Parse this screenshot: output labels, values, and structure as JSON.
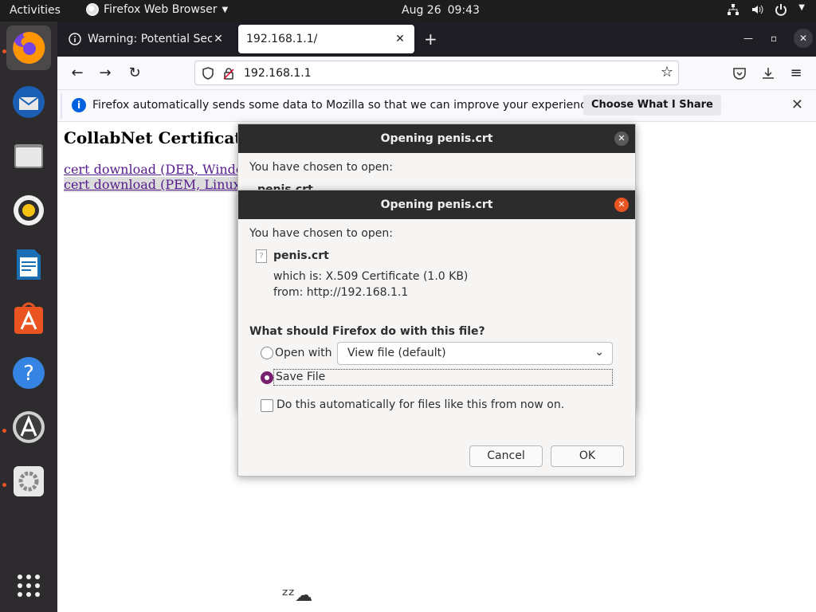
{
  "topbar": {
    "activities": "Activities",
    "app_name": "Firefox Web Browser",
    "date": "Aug 26",
    "time": "09:43"
  },
  "dock": {
    "items": [
      "firefox-icon",
      "thunderbird-icon",
      "files-icon",
      "rhythmbox-icon",
      "writer-icon",
      "software-icon",
      "help-icon",
      "updater-icon",
      "settings-icon",
      "app-grid-icon"
    ]
  },
  "browser": {
    "tabs": [
      {
        "title": "Warning: Potential Secur"
      },
      {
        "title": "192.168.1.1/"
      }
    ],
    "url": "192.168.1.1",
    "notification": {
      "message": "Firefox automatically sends some data to Mozilla so that we can improve your experience.",
      "button": "Choose What I Share"
    }
  },
  "page": {
    "heading": "CollabNet Certificate",
    "link1": "cert download (DER, Windo",
    "link2": "cert download (PEM, Linux"
  },
  "dialog_back": {
    "title": "Opening penis.crt",
    "chosen": "You have chosen to open:",
    "filename": "penis.crt"
  },
  "dialog": {
    "title": "Opening penis.crt",
    "chosen": "You have chosen to open:",
    "filename": "penis.crt",
    "which_is": "which is:  X.509 Certificate (1.0 KB)",
    "from": "from:  http://192.168.1.1",
    "question": "What should Firefox do with this file?",
    "open_with_label": "Open with",
    "open_with_value": "View file (default)",
    "save_label": "Save File",
    "auto_label": "Do this automatically for files like this from now on.",
    "cancel": "Cancel",
    "ok": "OK"
  }
}
